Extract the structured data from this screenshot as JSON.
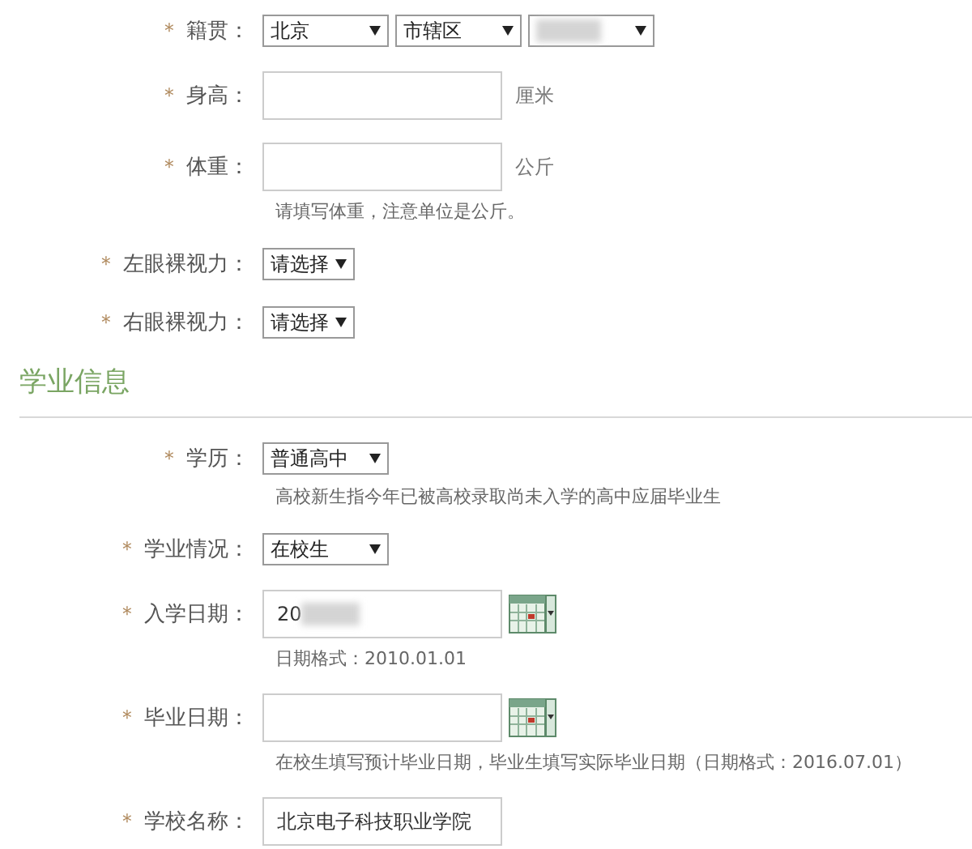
{
  "personal_rows": [
    {
      "kind": "selects",
      "marker": "＊",
      "label": "籍贯：",
      "selects": [
        {
          "value": "北京",
          "redacted": false,
          "compact": false
        },
        {
          "value": "市辖区",
          "redacted": false,
          "compact": false
        },
        {
          "redacted": true,
          "compact": false
        }
      ]
    },
    {
      "kind": "text",
      "marker": "＊",
      "label": "身高：",
      "unit": "厘米"
    },
    {
      "kind": "text",
      "marker": "＊",
      "label": "体重：",
      "unit": "公斤",
      "hint": "请填写体重，注意单位是公斤。"
    },
    {
      "kind": "selects",
      "marker": "＊",
      "label": "左眼裸视力：",
      "selects": [
        {
          "value": "请选择",
          "redacted": false,
          "compact": true
        }
      ]
    },
    {
      "kind": "selects",
      "marker": "＊",
      "label": "右眼裸视力：",
      "selects": [
        {
          "value": "请选择",
          "redacted": false,
          "compact": true
        }
      ]
    }
  ],
  "section_heading": "学业信息",
  "study_rows": [
    {
      "kind": "selects",
      "marker": "＊",
      "label": "学历：",
      "selects": [
        {
          "value": "普通高中",
          "redacted": false,
          "compact": false
        }
      ],
      "hint": "高校新生指今年已被高校录取尚未入学的高中应届毕业生"
    },
    {
      "kind": "selects",
      "marker": "＊",
      "label": "学业情况：",
      "selects": [
        {
          "value": "在校生",
          "redacted": false,
          "compact": false
        }
      ]
    },
    {
      "kind": "date",
      "marker": "＊",
      "label": "入学日期：",
      "value": "20",
      "redacted": true,
      "hint": "日期格式：2010.01.01"
    },
    {
      "kind": "date",
      "marker": "＊",
      "label": "毕业日期：",
      "hint": "在校生填写预计毕业日期，毕业生填写实际毕业日期（日期格式：2016.07.01）"
    },
    {
      "kind": "text",
      "marker": "＊",
      "label": "学校名称：",
      "value": "北京电子科技职业学院"
    }
  ]
}
